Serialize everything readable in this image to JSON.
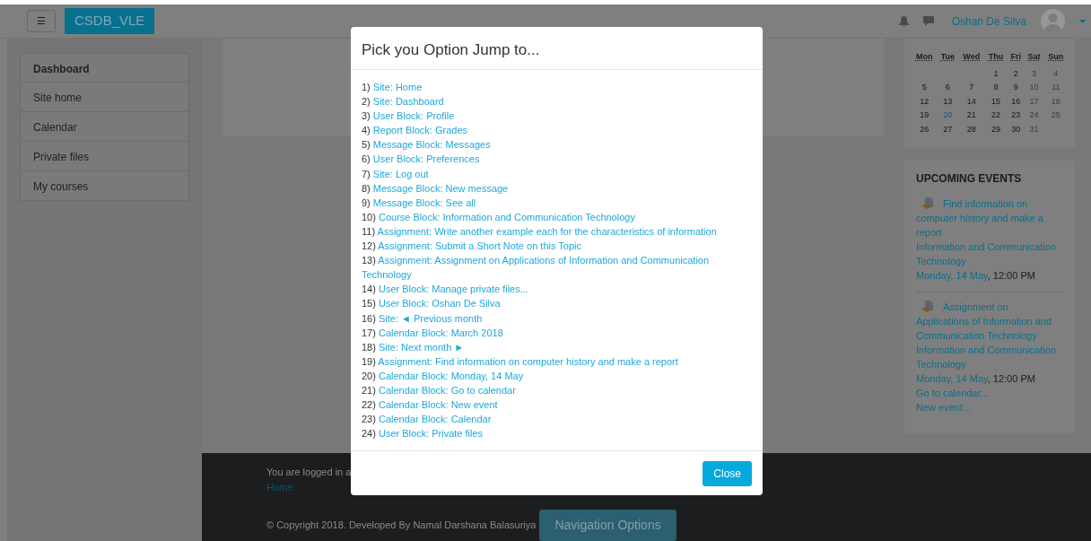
{
  "navbar": {
    "menu_button": "☰",
    "brand": "CSDB_VLE",
    "user_name": "Oshan De Silva"
  },
  "sidebar": {
    "items": [
      {
        "label": "Dashboard",
        "selected": true
      },
      {
        "label": "Site home",
        "selected": false
      },
      {
        "label": "Calendar",
        "selected": false
      },
      {
        "label": "Private files",
        "selected": false
      },
      {
        "label": "My courses",
        "selected": false
      }
    ]
  },
  "calendar": {
    "weekdays": [
      "Mon",
      "Tue",
      "Wed",
      "Thu",
      "Fri",
      "Sat",
      "Sun"
    ],
    "weeks": [
      {
        "kind": "first",
        "days": [
          {
            "day": "1",
            "kind": "weekday"
          },
          {
            "day": "2",
            "kind": "weekday"
          },
          {
            "day": "3",
            "kind": "weekend"
          },
          {
            "day": "4",
            "kind": "weekend"
          }
        ]
      },
      {
        "kind": "full",
        "days": [
          {
            "day": "5",
            "kind": "weekday"
          },
          {
            "day": "6",
            "kind": "weekday"
          },
          {
            "day": "7",
            "kind": "weekday"
          },
          {
            "day": "8",
            "kind": "weekday"
          },
          {
            "day": "9",
            "kind": "weekday"
          },
          {
            "day": "10",
            "kind": "weekend"
          },
          {
            "day": "11",
            "kind": "weekend"
          }
        ]
      },
      {
        "kind": "full",
        "days": [
          {
            "day": "12",
            "kind": "weekday"
          },
          {
            "day": "13",
            "kind": "weekday"
          },
          {
            "day": "14",
            "kind": "weekday"
          },
          {
            "day": "15",
            "kind": "weekday"
          },
          {
            "day": "16",
            "kind": "weekday"
          },
          {
            "day": "17",
            "kind": "weekend"
          },
          {
            "day": "18",
            "kind": "weekend"
          }
        ]
      },
      {
        "kind": "full",
        "days": [
          {
            "day": "19",
            "kind": "weekday"
          },
          {
            "day": "20",
            "kind": "link"
          },
          {
            "day": "21",
            "kind": "weekday"
          },
          {
            "day": "22",
            "kind": "weekday"
          },
          {
            "day": "23",
            "kind": "weekday"
          },
          {
            "day": "24",
            "kind": "weekend"
          },
          {
            "day": "25",
            "kind": "weekend"
          }
        ]
      },
      {
        "kind": "last",
        "days": [
          {
            "day": "26",
            "kind": "weekday"
          },
          {
            "day": "27",
            "kind": "weekday"
          },
          {
            "day": "28",
            "kind": "weekday"
          },
          {
            "day": "29",
            "kind": "weekday"
          },
          {
            "day": "30",
            "kind": "weekday"
          },
          {
            "day": "31",
            "kind": "weekend"
          }
        ]
      }
    ]
  },
  "upcoming_events": {
    "title": "UPCOMING EVENTS",
    "events": [
      {
        "name": "Find information on computer history and make a report",
        "course": "Information and Communication Technology",
        "date": "Monday, 14 May",
        "time": ", 12:00 PM"
      },
      {
        "name": "Assignment on Applications of Information and Communication Technology",
        "course": "Information and Communication Technology",
        "date": "Monday, 14 May",
        "time": ", 12:00 PM"
      }
    ],
    "links": [
      "Go to calendar...",
      "New event..."
    ]
  },
  "footer": {
    "logged_in_text": "You are logged in a",
    "home_link": "Home",
    "copyright": "© Copyright 2018. Developed By Namal Darshana Balasuriya",
    "nav_button": "Navigation Options"
  },
  "modal": {
    "title": "Pick you Option Jump to...",
    "options": [
      {
        "number": "1)",
        "label": "Site: Home"
      },
      {
        "number": "2)",
        "label": "Site: Dashboard"
      },
      {
        "number": "3)",
        "label": "User Block: Profile"
      },
      {
        "number": "4)",
        "label": "Report Block: Grades"
      },
      {
        "number": "5)",
        "label": "Message Block: Messages"
      },
      {
        "number": "6)",
        "label": "User Block: Preferences"
      },
      {
        "number": "7)",
        "label": "Site: Log out"
      },
      {
        "number": "8)",
        "label": "Message Block: New message"
      },
      {
        "number": "9)",
        "label": "Message Block: See all"
      },
      {
        "number": "10)",
        "label": "Course Block: Information and Communication Technology"
      },
      {
        "number": "11)",
        "label": "Assignment: Write another example each for the characteristics of information"
      },
      {
        "number": "12)",
        "label": "Assignment: Submit a Short Note on this Topic"
      },
      {
        "number": "13)",
        "label": "Assignment: Assignment on Applications of Information and Communication Technology"
      },
      {
        "number": "14)",
        "label": "User Block: Manage private files..."
      },
      {
        "number": "15)",
        "label": "User Block: Oshan De Silva"
      },
      {
        "number": "16)",
        "label": "Site: ◄ Previous month"
      },
      {
        "number": "17)",
        "label": "Calendar Block: March 2018"
      },
      {
        "number": "18)",
        "label": "Site: Next month ►"
      },
      {
        "number": "19)",
        "label": "Assignment: Find information on computer history and make a report"
      },
      {
        "number": "20)",
        "label": "Calendar Block: Monday, 14 May"
      },
      {
        "number": "21)",
        "label": "Calendar Block: Go to calendar"
      },
      {
        "number": "22)",
        "label": "Calendar Block: New event"
      },
      {
        "number": "23)",
        "label": "Calendar Block: Calendar"
      },
      {
        "number": "24)",
        "label": "User Block: Private files"
      }
    ],
    "close_button": "Close"
  }
}
